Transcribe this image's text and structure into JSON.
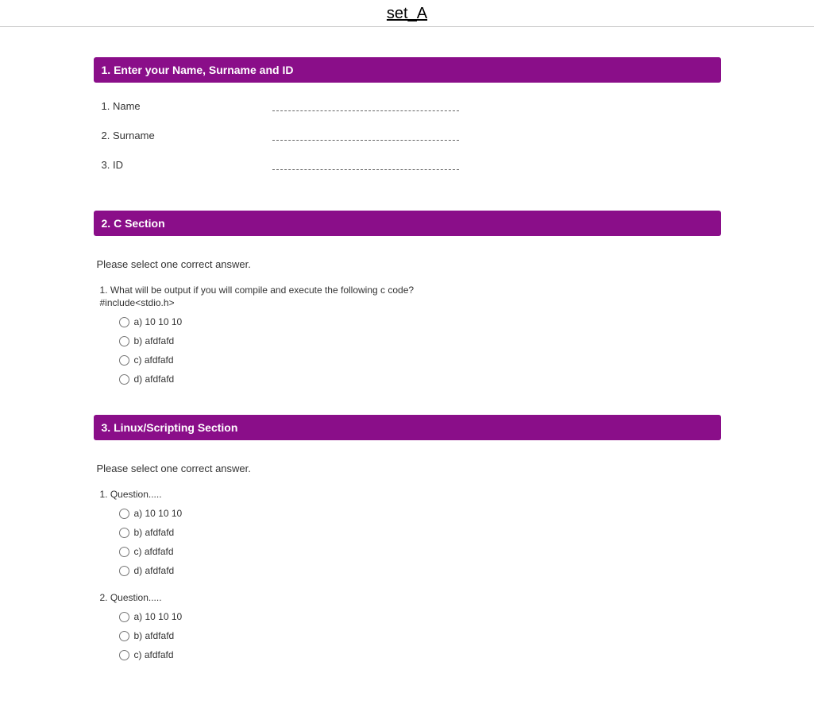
{
  "pageTitle": "set_A",
  "sections": {
    "s1": {
      "header": "1. Enter your Name, Surname and ID",
      "fields": [
        {
          "label": "1. Name"
        },
        {
          "label": "2. Surname"
        },
        {
          "label": "3. ID"
        }
      ]
    },
    "s2": {
      "header": "2. C Section",
      "instruction": "Please select one correct answer.",
      "questions": [
        {
          "text": "1. What will be output if you will compile and execute the following c code?",
          "sub": "#include<stdio.h>",
          "options": [
            "a) 10 10 10",
            "b) afdfafd",
            "c) afdfafd",
            "d) afdfafd"
          ]
        }
      ]
    },
    "s3": {
      "header": "3. Linux/Scripting Section",
      "instruction": "Please select one correct answer.",
      "questions": [
        {
          "text": "1. Question.....",
          "options": [
            "a) 10 10 10",
            "b) afdfafd",
            "c) afdfafd",
            "d) afdfafd"
          ]
        },
        {
          "text": "2. Question.....",
          "options": [
            "a) 10 10 10",
            "b) afdfafd",
            "c) afdfafd"
          ]
        }
      ]
    }
  }
}
